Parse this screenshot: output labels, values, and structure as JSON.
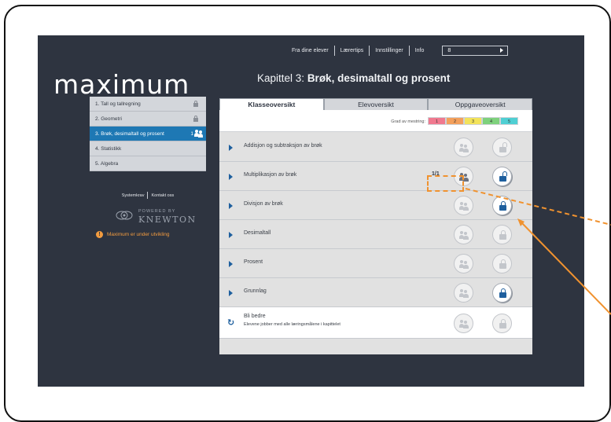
{
  "topnav": {
    "links": [
      "Fra dine elever",
      "Lærertips",
      "Innstillinger",
      "Info"
    ],
    "class_select_value": "8"
  },
  "logo": "maximum",
  "chapter": {
    "prefix": "Kapittel 3:",
    "name": "Brøk, desimaltall og prosent"
  },
  "sidebar": {
    "items": [
      {
        "label": "1. Tall og tallregning",
        "locked": true
      },
      {
        "label": "2. Geometri",
        "locked": true
      },
      {
        "label": "3. Brøk, desimaltall og prosent",
        "count": "1",
        "active": true
      },
      {
        "label": "4. Statistikk"
      },
      {
        "label": "5. Algebra"
      }
    ],
    "links": [
      "Systemkrav",
      "Kontakt oss"
    ],
    "powered_by": "POWERED BY",
    "brand": "KNEWTON",
    "dev_note": "Maximum er under utvikling"
  },
  "tabs": [
    "Klasseoversikt",
    "Elevoversikt",
    "Oppgaveoversikt"
  ],
  "legend": {
    "label": "Grad av mestring:",
    "levels": [
      {
        "value": "1",
        "color": "#f0798f"
      },
      {
        "value": "2",
        "color": "#f3a05c"
      },
      {
        "value": "3",
        "color": "#f3e35a"
      },
      {
        "value": "4",
        "color": "#7ed17c"
      },
      {
        "value": "5",
        "color": "#4fcfd3"
      }
    ]
  },
  "rows": [
    {
      "label": "Addisjon og subtraksjon av brøk"
    },
    {
      "label": "Multiplikasjon av brøk",
      "badge": "1/1"
    },
    {
      "label": "Divisjon av brøk"
    },
    {
      "label": "Desimaltall"
    },
    {
      "label": "Prosent"
    },
    {
      "label": "Grunnlag"
    }
  ],
  "improve": {
    "title": "Bli bedre",
    "subtitle": "Elevene jobber med alle læringsmålene i kapittelet"
  },
  "colors": {
    "background": "#2e3440",
    "accent": "#1e78b4",
    "annotation": "#f0922f"
  }
}
